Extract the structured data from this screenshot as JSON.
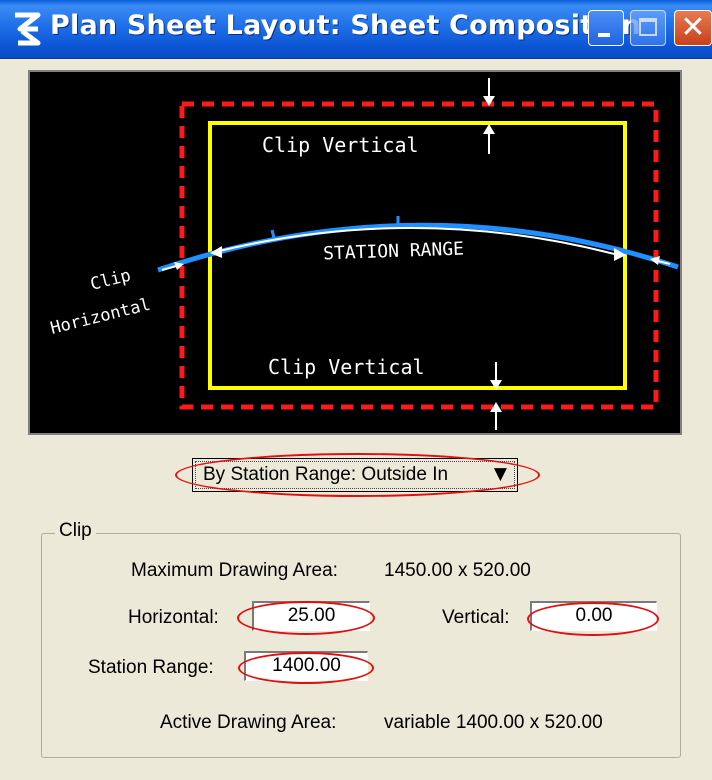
{
  "window": {
    "title": "Plan Sheet Layout: Sheet Composition",
    "icon": "app-icon",
    "controls": {
      "minimize": "minimize-icon",
      "maximize": "maximize-icon",
      "close": "close-icon"
    }
  },
  "preview": {
    "clip_vertical_top": "Clip Vertical",
    "clip_vertical_bottom": "Clip Vertical",
    "station_range": "STATION RANGE",
    "clip_horizontal_line1": "Clip",
    "clip_horizontal_line2": "Horizontal",
    "colors": {
      "background": "#000000",
      "outer_clip": "#ff1a1a",
      "sheet": "#ffff00",
      "alignment": "#1e90ff",
      "annotation": "#ffffff"
    }
  },
  "mode_select": {
    "value": "By Station Range: Outside In",
    "arrow_icon": "dropdown-arrow-icon"
  },
  "clip": {
    "group_label": "Clip",
    "max_area_label": "Maximum Drawing Area:",
    "max_area_value": "1450.00 x  520.00",
    "horizontal_label": "Horizontal:",
    "horizontal_value": "25.00",
    "vertical_label": "Vertical:",
    "vertical_value": "0.00",
    "station_range_label": "Station Range:",
    "station_range_value": "1400.00",
    "active_area_label": "Active Drawing Area:",
    "active_area_value": "variable  1400.00 x  520.00"
  },
  "highlight_color": "#e01010"
}
